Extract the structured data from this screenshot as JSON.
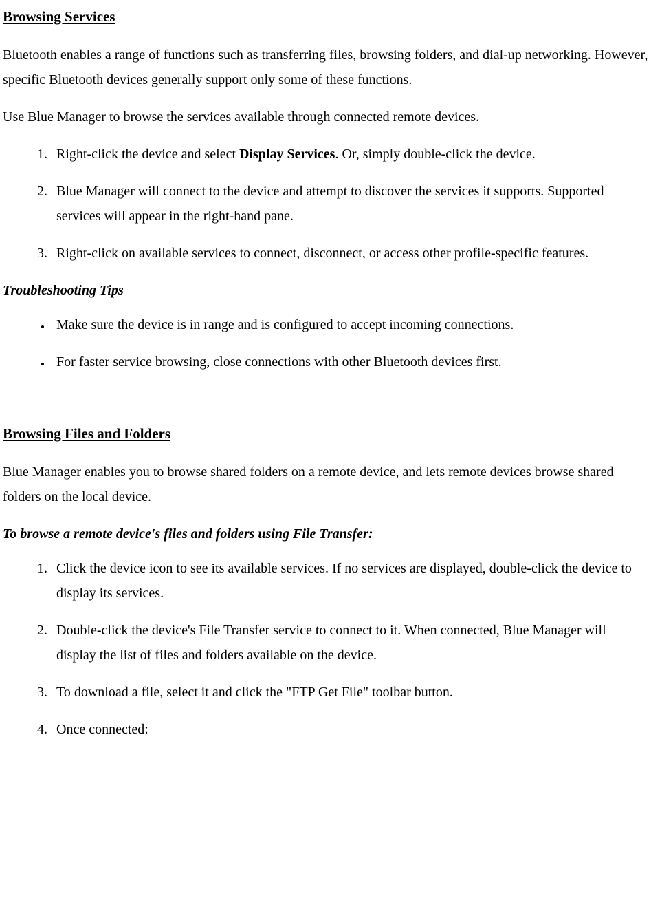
{
  "section1": {
    "heading": "Browsing Services",
    "para1": "Bluetooth enables a range of functions such as transferring files, browsing folders, and dial-up networking. However, specific Bluetooth devices generally support only some of these functions.",
    "para2": "Use Blue Manager to browse the services available through connected remote devices.",
    "step1_pre": "Right-click the device and select ",
    "step1_bold": "Display Services",
    "step1_post": ". Or, simply double-click the device.",
    "step2": "Blue Manager will connect to the device and attempt to discover the services it supports. Supported services will appear in the right-hand pane.",
    "step3": "Right-click on available services to connect, disconnect, or access other profile-specific features.",
    "tips_heading": "Troubleshooting Tips",
    "tip1": "Make sure the device is in range and is configured to accept incoming connections.",
    "tip2": "For faster service browsing, close connections with other Bluetooth devices first."
  },
  "section2": {
    "heading": "Browsing Files and Folders",
    "para1": "Blue Manager enables you to browse shared folders on a remote device, and lets remote devices browse shared folders on the local device.",
    "sub_heading": "To browse a remote device's files and folders using File Transfer:",
    "step1": "Click the device icon to see its available services. If no services are displayed, double-click the device to display its services.",
    "step2": "Double-click the device's File Transfer service to connect to it. When connected, Blue Manager will display the list of files and folders available on the device.",
    "step3": "To download a file, select it and click the \"FTP Get File\" toolbar button.",
    "step4": "Once connected:"
  }
}
